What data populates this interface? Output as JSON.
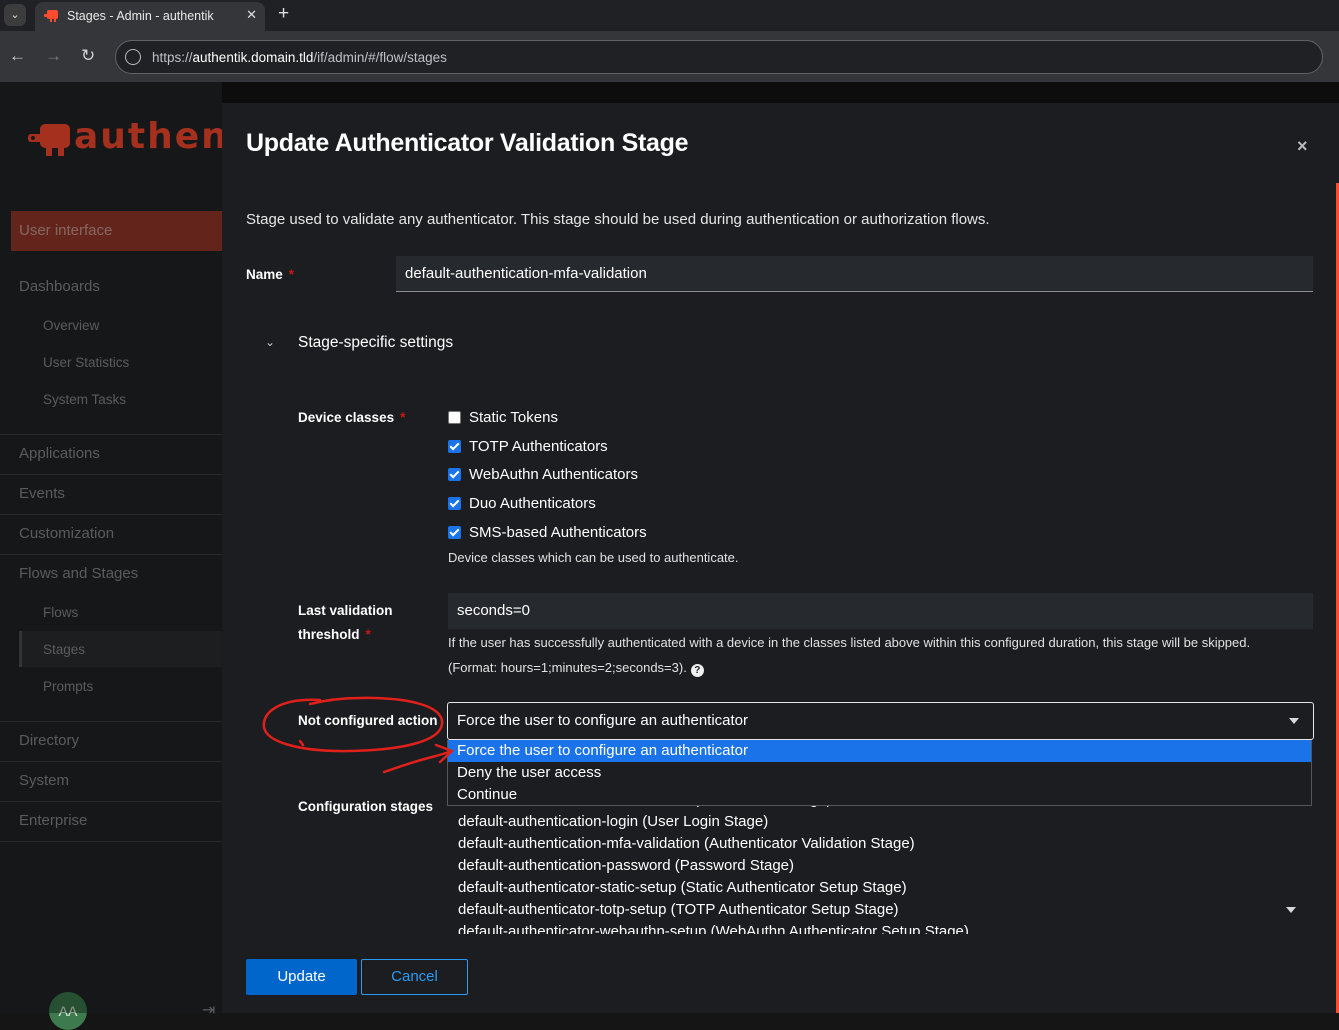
{
  "browser": {
    "tab_title": "Stages - Admin - authentik",
    "tab_close": "✕",
    "new_tab": "+",
    "url_prefix": "https://",
    "url_host": "authentik.domain.tld",
    "url_path": "/if/admin/#/flow/stages"
  },
  "sidebar": {
    "logo_text": "authentik",
    "user_interface": "User interface",
    "dashboards": "Dashboards",
    "overview": "Overview",
    "user_statistics": "User Statistics",
    "system_tasks": "System Tasks",
    "applications": "Applications",
    "events": "Events",
    "customization": "Customization",
    "flows_and_stages": "Flows and Stages",
    "flows": "Flows",
    "stages": "Stages",
    "prompts": "Prompts",
    "directory": "Directory",
    "system": "System",
    "enterprise": "Enterprise",
    "avatar_initials": "AA"
  },
  "modal": {
    "title": "Update Authenticator Validation Stage",
    "close": "×",
    "description": "Stage used to validate any authenticator. This stage should be used during authentication or authorization flows.",
    "name_label": "Name",
    "name_value": "default-authentication-mfa-validation",
    "section_title": "Stage-specific settings",
    "device_classes_label": "Device classes",
    "device_classes": [
      {
        "label": "Static Tokens",
        "checked": false
      },
      {
        "label": "TOTP Authenticators",
        "checked": true
      },
      {
        "label": "WebAuthn Authenticators",
        "checked": true
      },
      {
        "label": "Duo Authenticators",
        "checked": true
      },
      {
        "label": "SMS-based Authenticators",
        "checked": true
      }
    ],
    "device_classes_help": "Device classes which can be used to authenticate.",
    "last_validation_label_1": "Last validation",
    "last_validation_label_2": "threshold",
    "last_validation_value": "seconds=0",
    "last_validation_help_1": "If the user has successfully authenticated with a device in the classes listed above within this configured duration, this stage will be skipped.",
    "last_validation_help_2": "(Format: hours=1;minutes=2;seconds=3).",
    "help_icon": "?",
    "not_configured_label": "Not configured action",
    "not_configured_value": "Force the user to configure an authenticator",
    "not_configured_options": [
      "Force the user to configure an authenticator",
      "Deny the user access",
      "Continue"
    ],
    "configuration_stages_label": "Configuration stages",
    "configuration_stages": [
      "default-authentication-identification (Identification Stage)",
      "default-authentication-login (User Login Stage)",
      "default-authentication-mfa-validation (Authenticator Validation Stage)",
      "default-authentication-password (Password Stage)",
      "default-authenticator-static-setup (Static Authenticator Setup Stage)",
      "default-authenticator-totp-setup (TOTP Authenticator Setup Stage)",
      "default-authenticator-webauthn-setup (WebAuthn Authenticator Setup Stage)"
    ],
    "update_button": "Update",
    "cancel_button": "Cancel"
  },
  "colors": {
    "brand": "#fd4b2d",
    "primary": "#0066cc",
    "selected_option": "#1a73e8",
    "annotation": "#e0201a"
  }
}
